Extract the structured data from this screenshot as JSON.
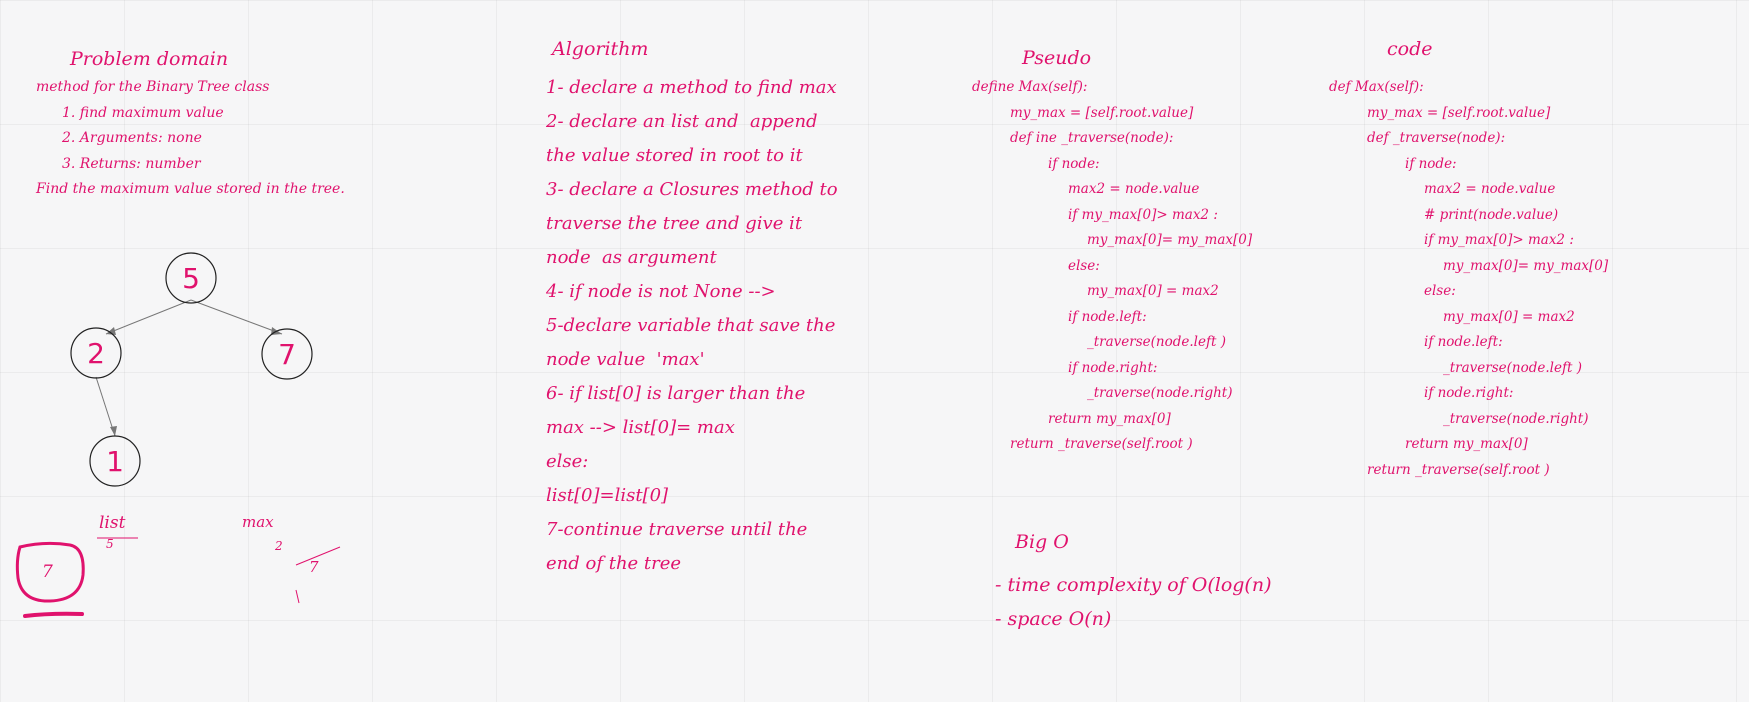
{
  "problem": {
    "title": "Problem domain",
    "lines": [
      "method for the Binary Tree class",
      "1. find maximum value",
      "2. Arguments: none",
      "3. Returns: number",
      "Find the maximum value stored in the tree."
    ]
  },
  "tree": {
    "nodes": [
      "5",
      "2",
      "7",
      "1"
    ]
  },
  "scratch": {
    "list_label": "list",
    "list_value": "5",
    "max_label": "max",
    "max_value_1": "2",
    "max_value_2": "7",
    "circled_value": "7"
  },
  "algorithm": {
    "title": "Algorithm",
    "lines": [
      "1- declare a method to find max",
      "2- declare an list and  append",
      "the value stored in root to it",
      "3- declare a Closures method to",
      "traverse the tree and give it",
      "node  as argument",
      "4- if node is not None -->",
      "5-declare variable that save the",
      "node value  'max'",
      "6- if list[0] is larger than the",
      "max --> list[0]= max",
      "else:",
      "list[0]=list[0]",
      "7-continue traverse until the",
      "end of the tree"
    ]
  },
  "pseudo": {
    "title": "Pseudo",
    "lines": [
      "define Max(self):",
      "my_max = [self.root.value]",
      "def ine _traverse(node):",
      "if node:",
      "max2 = node.value",
      "if my_max[0]> max2 :",
      "my_max[0]= my_max[0]",
      "else:",
      "my_max[0] = max2",
      "if node.left:",
      "_traverse(node.left )",
      "if node.right:",
      "_traverse(node.right)",
      "return my_max[0]",
      "return _traverse(self.root )"
    ]
  },
  "code": {
    "title": "code",
    "lines": [
      "def Max(self):",
      "my_max = [self.root.value]",
      "def _traverse(node):",
      "if node:",
      "max2 = node.value",
      "# print(node.value)",
      "if my_max[0]> max2 :",
      "my_max[0]= my_max[0]",
      "else:",
      "my_max[0] = max2",
      "if node.left:",
      "_traverse(node.left )",
      "if node.right:",
      "_traverse(node.right)",
      "return my_max[0]",
      "return _traverse(self.root )"
    ]
  },
  "bigo": {
    "title": "Big O",
    "lines": [
      "- time complexity of O(log(n)",
      "- space O(n)"
    ]
  },
  "colors": {
    "ink": "#e0126d",
    "background": "#f6f6f7",
    "node_stroke": "#222222"
  }
}
